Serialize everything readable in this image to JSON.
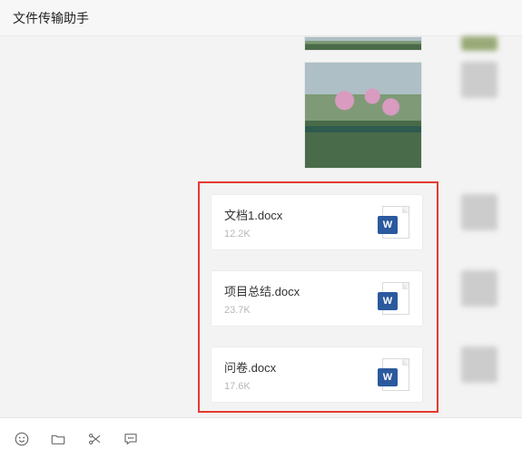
{
  "header": {
    "title": "文件传输助手"
  },
  "messages": {
    "photo_top_crop": {
      "type": "image"
    },
    "photo_main": {
      "type": "image"
    },
    "files": [
      {
        "name": "文档1.docx",
        "size": "12.2K",
        "icon_letter": "W"
      },
      {
        "name": "项目总结.docx",
        "size": "23.7K",
        "icon_letter": "W"
      },
      {
        "name": "问卷.docx",
        "size": "17.6K",
        "icon_letter": "W"
      }
    ]
  },
  "highlight_box": {
    "purpose": "three file messages emphasized"
  },
  "toolbar": {
    "icons": [
      "emoji",
      "folder",
      "scissors",
      "chat-bubble"
    ]
  }
}
